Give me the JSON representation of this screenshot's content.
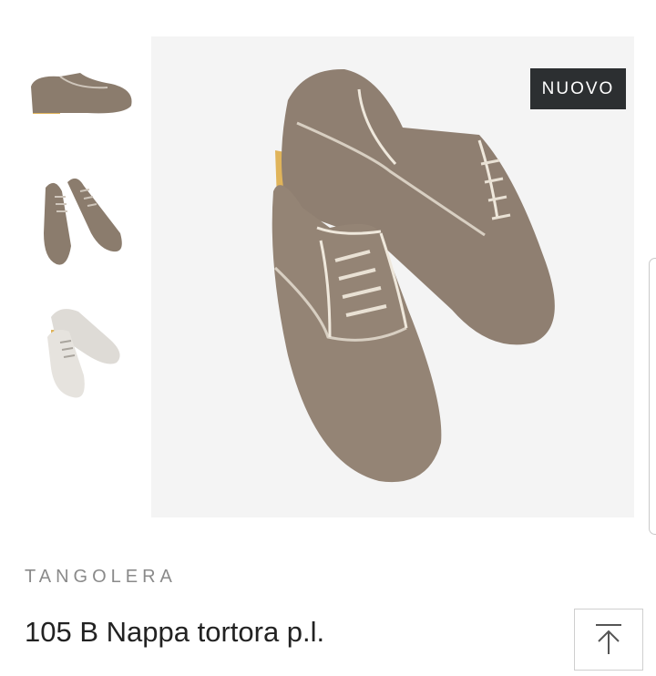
{
  "gallery": {
    "badge_label": "NUOVO",
    "thumbnails": [
      {
        "icon": "shoe-side-view-icon",
        "color": "#8b7c6d"
      },
      {
        "icon": "shoe-pair-top-view-icon",
        "color": "#8b7c6d"
      },
      {
        "icon": "shoe-pair-white-icon",
        "color": "#dedbd6"
      }
    ],
    "main_image": {
      "icon": "shoe-pair-photo-icon",
      "color": "#8f7f71",
      "heel_color": "#e0b45a"
    }
  },
  "product": {
    "brand": "TANGOLERA",
    "title": "105 B Nappa tortora p.l."
  },
  "controls": {
    "back_to_top": {
      "icon": "arrow-up-to-top-icon"
    }
  }
}
